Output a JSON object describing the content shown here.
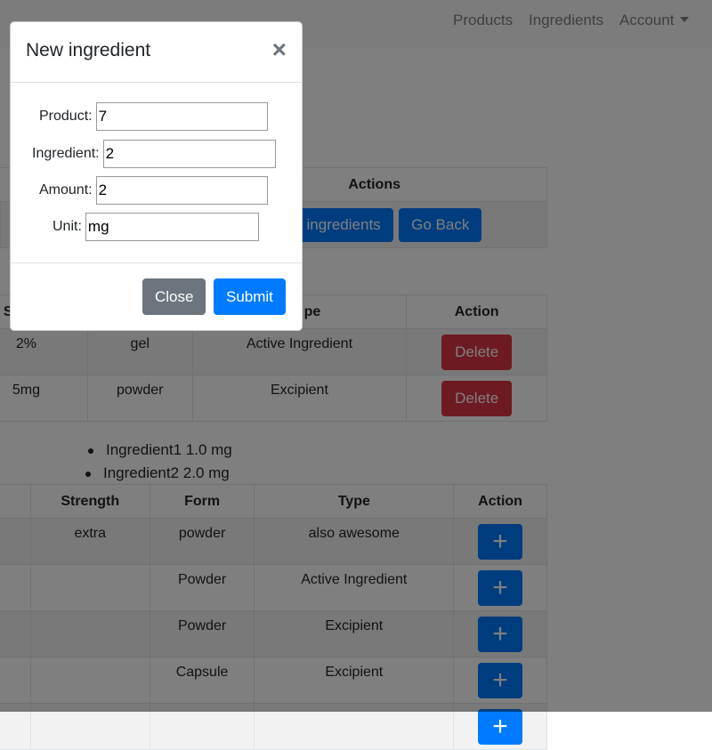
{
  "navbar": {
    "products": "Products",
    "ingredients": "Ingredients",
    "account": "Account"
  },
  "product_table": {
    "header_actions": "Actions",
    "add_ingredients_label": "d ingredients",
    "go_back_label": "Go Back"
  },
  "ingredients_table": {
    "headers": [
      "St",
      "",
      "pe",
      "Action"
    ],
    "rows": [
      {
        "strength": "2%",
        "form": "gel",
        "type": "Active Ingredient",
        "delete": "Delete"
      },
      {
        "strength": "5mg",
        "form": "powder",
        "type": "Excipient",
        "delete": "Delete"
      }
    ]
  },
  "ingredient_list": [
    "Ingredient1 1.0 mg",
    "Ingredient2 2.0 mg"
  ],
  "available_table": {
    "headers": [
      "",
      "Strength",
      "Form",
      "Type",
      "Action"
    ],
    "rows": [
      {
        "strength": "extra",
        "form": "powder",
        "type": "also awesome"
      },
      {
        "strength": "",
        "form": "Powder",
        "type": "Active Ingredient"
      },
      {
        "strength": "",
        "form": "Powder",
        "type": "Excipient"
      },
      {
        "strength": "",
        "form": "Capsule",
        "type": "Excipient"
      }
    ],
    "add_symbol": "+"
  },
  "modal": {
    "title": "New ingredient",
    "close_symbol": "×",
    "fields": {
      "product": {
        "label": "Product:",
        "value": "7"
      },
      "ingredient": {
        "label": "Ingredient:",
        "value": "2"
      },
      "amount": {
        "label": "Amount:",
        "value": "2"
      },
      "unit": {
        "label": "Unit:",
        "value": "mg"
      }
    },
    "close_label": "Close",
    "submit_label": "Submit"
  },
  "colors": {
    "primary": "#007bff",
    "danger": "#dc3545",
    "secondary": "#6c757d"
  }
}
